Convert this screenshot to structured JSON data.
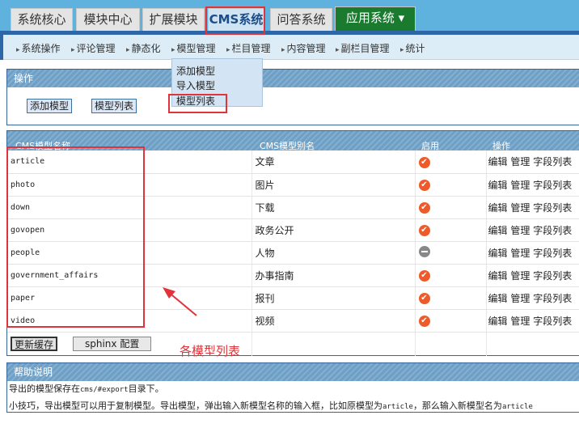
{
  "top_tabs": [
    "系统核心",
    "模块中心",
    "扩展模块",
    "CMS系统",
    "问答系统",
    "应用系统 ▾"
  ],
  "subnav": [
    "系统操作",
    "评论管理",
    "静态化",
    "模型管理",
    "栏目管理",
    "内容管理",
    "副栏目管理",
    "统计"
  ],
  "dropdown": [
    "添加模型",
    "导入模型",
    "模型列表"
  ],
  "ops_panel": {
    "title": "操作",
    "buttons": [
      "添加模型",
      "模型列表"
    ]
  },
  "table": {
    "headers": [
      "CMS模型名称",
      "CMS模型别名",
      "启用",
      "操作"
    ],
    "rows": [
      {
        "name": "article",
        "alias": "文章",
        "enabled": true
      },
      {
        "name": "photo",
        "alias": "图片",
        "enabled": true
      },
      {
        "name": "down",
        "alias": "下载",
        "enabled": true
      },
      {
        "name": "govopen",
        "alias": "政务公开",
        "enabled": true
      },
      {
        "name": "people",
        "alias": "人物",
        "enabled": false
      },
      {
        "name": "government_affairs",
        "alias": "办事指南",
        "enabled": true
      },
      {
        "name": "paper",
        "alias": "报刊",
        "enabled": true
      },
      {
        "name": "video",
        "alias": "视频",
        "enabled": true
      }
    ],
    "actions": [
      "编辑",
      "管理",
      "字段列表"
    ],
    "footer_buttons": [
      "更新缓存",
      "sphinx 配置"
    ]
  },
  "annotation": "各模型列表",
  "help": {
    "title": "帮助说明",
    "line1_a": "导出的模型保存在",
    "line1_b": "cms/#export",
    "line1_c": "目录下。",
    "line2_a": "小技巧，导出模型可以用于复制模型。导出模型，弹出输入新模型名称的输入框，比如原模型为",
    "line2_b": "article",
    "line2_c": "，那么输入新模型名为",
    "line2_d": "article"
  },
  "colors": {
    "accent": "#2e67a8",
    "annotation": "#e0343a",
    "enabled": "#ef5a2a"
  }
}
